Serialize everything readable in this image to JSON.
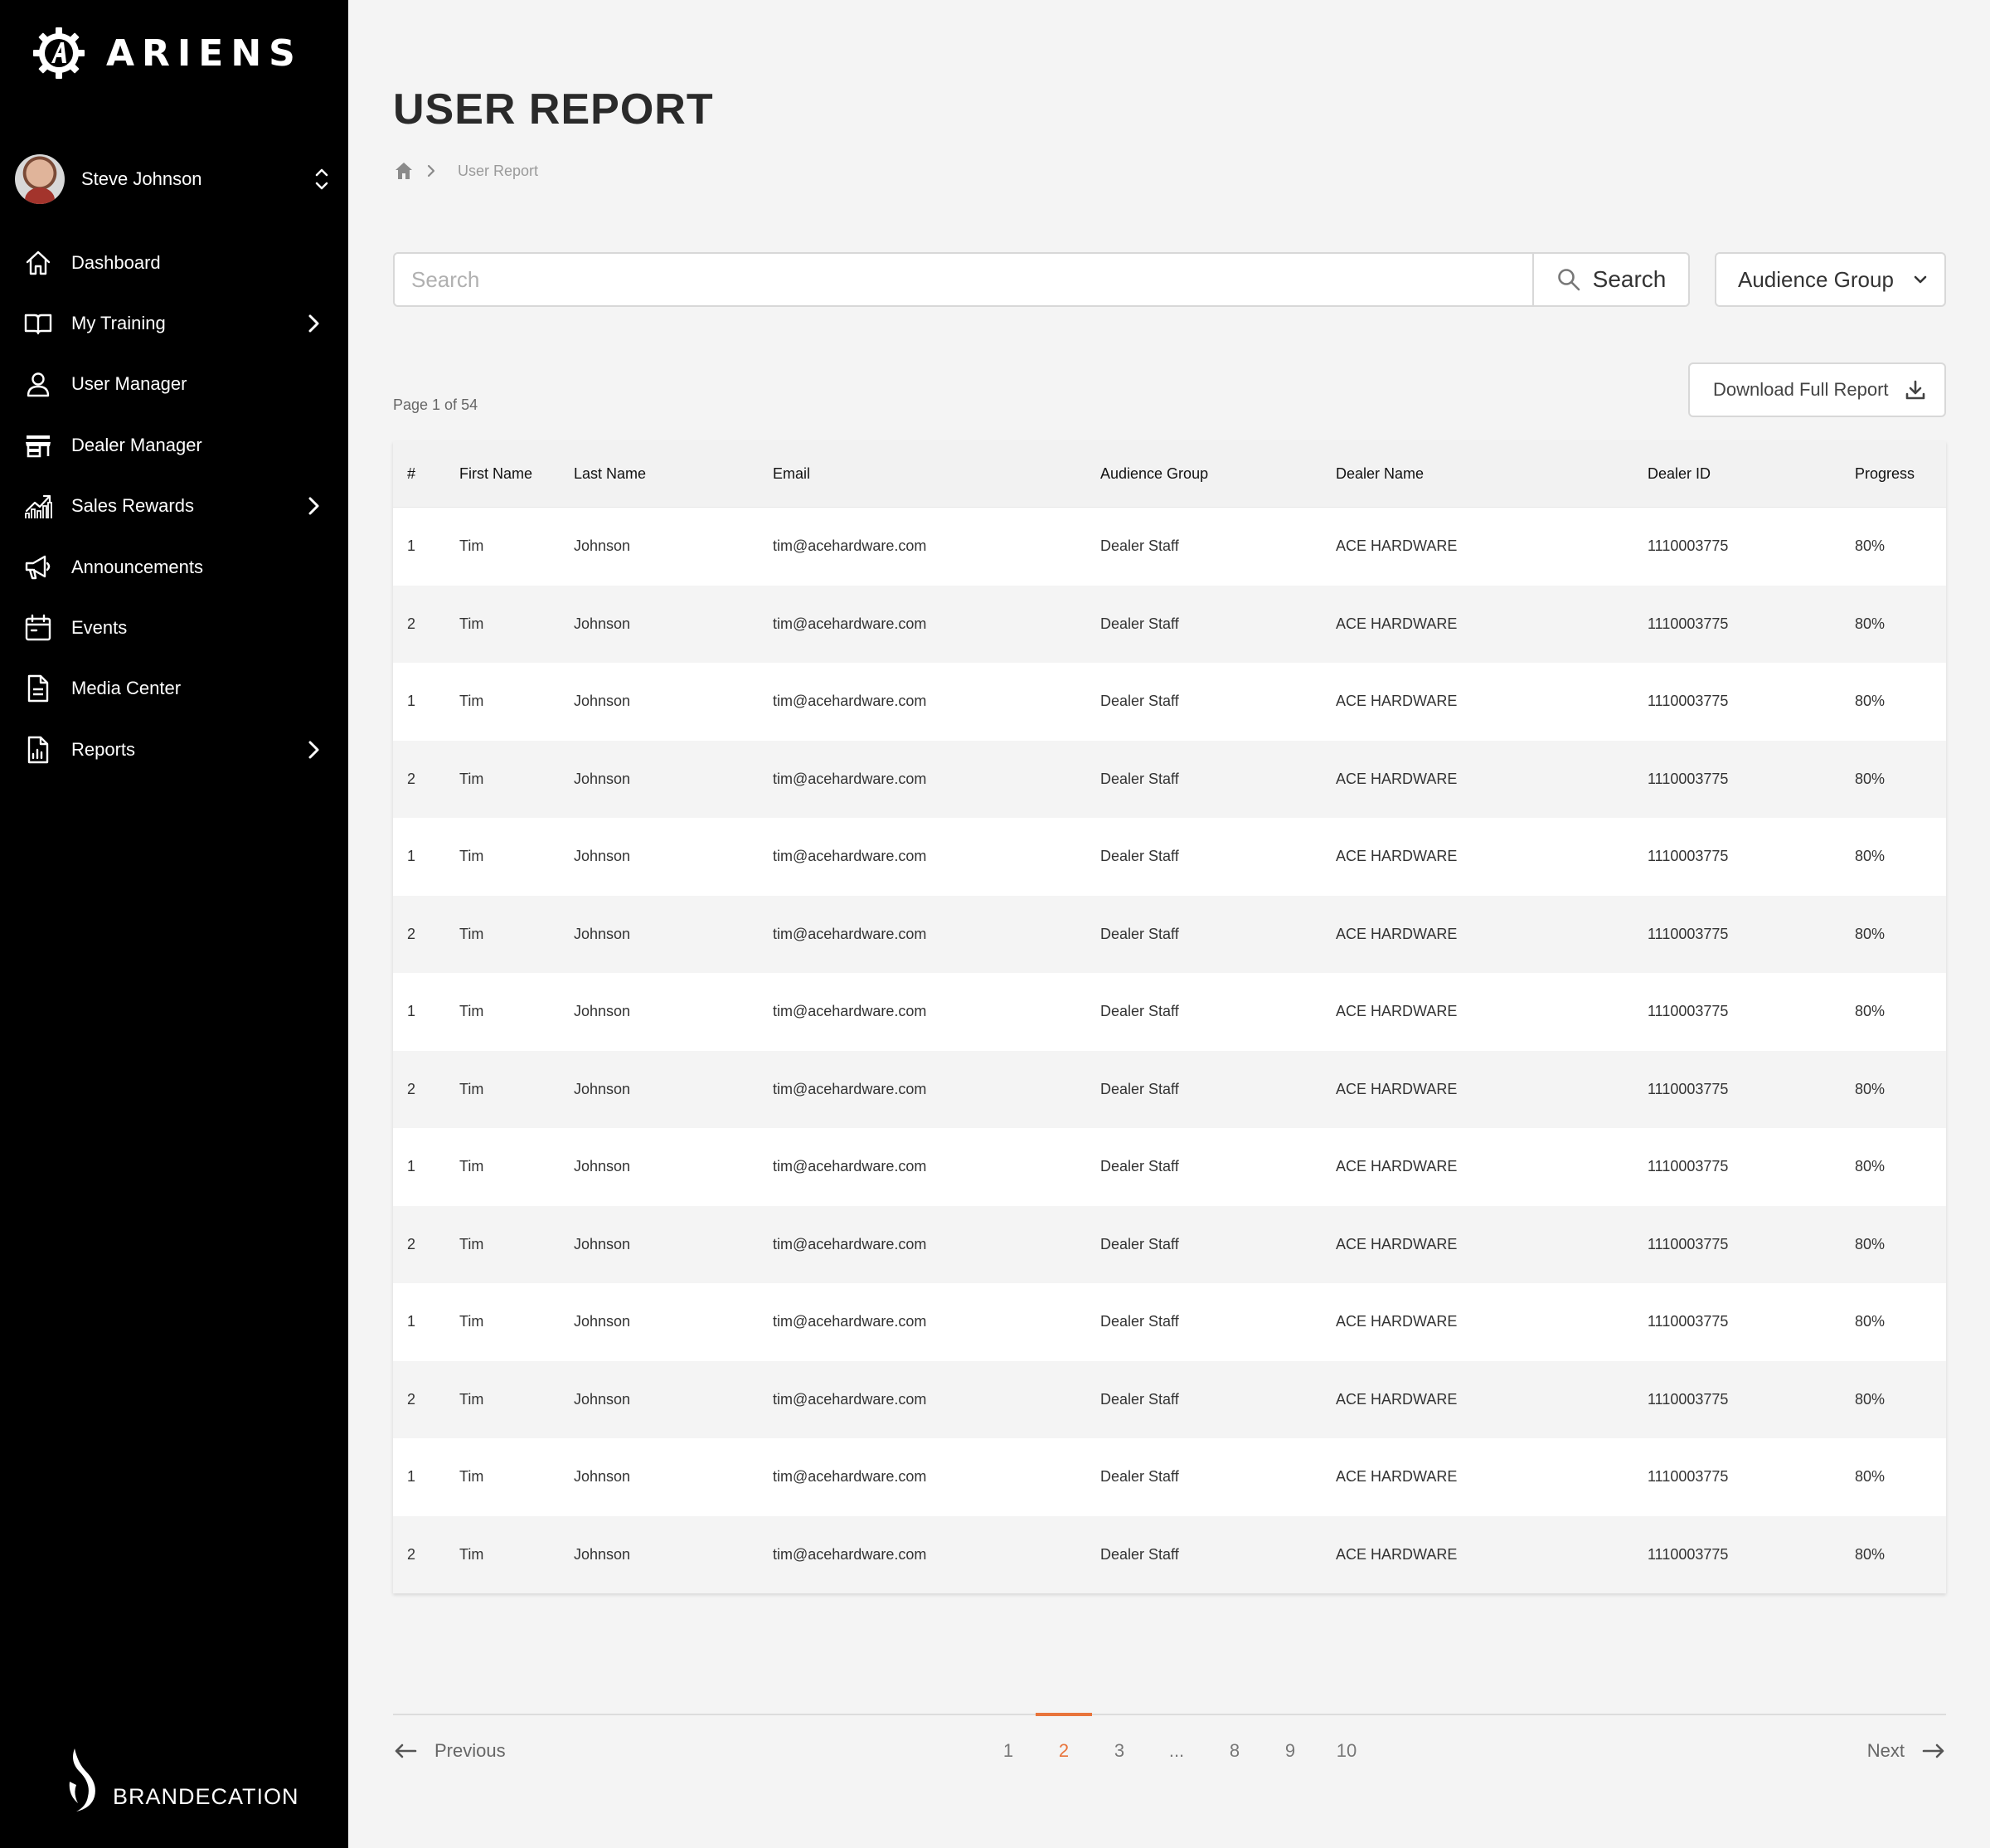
{
  "brand": {
    "logo_text": "ARIENS",
    "footer_text": "BRANDECATION"
  },
  "user": {
    "name": "Steve Johnson"
  },
  "nav": [
    {
      "label": "Dashboard",
      "icon": "home-icon",
      "chevron": false
    },
    {
      "label": "My Training",
      "icon": "book-icon",
      "chevron": true
    },
    {
      "label": "User Manager",
      "icon": "user-icon",
      "chevron": false
    },
    {
      "label": "Dealer Manager",
      "icon": "store-icon",
      "chevron": false
    },
    {
      "label": "Sales Rewards",
      "icon": "chart-icon",
      "chevron": true
    },
    {
      "label": "Announcements",
      "icon": "megaphone-icon",
      "chevron": false
    },
    {
      "label": "Events",
      "icon": "calendar-icon",
      "chevron": false
    },
    {
      "label": "Media Center",
      "icon": "document-icon",
      "chevron": false
    },
    {
      "label": "Reports",
      "icon": "report-icon",
      "chevron": true
    }
  ],
  "page": {
    "title": "USER REPORT",
    "breadcrumb_current": "User Report"
  },
  "search": {
    "placeholder": "Search",
    "button_label": "Search"
  },
  "filter": {
    "audience_label": "Audience Group"
  },
  "report": {
    "page_info": "Page 1 of 54",
    "download_label": "Download Full Report"
  },
  "table": {
    "headers": [
      "#",
      "First Name",
      "Last Name",
      "Email",
      "Audience Group",
      "Dealer Name",
      "Dealer ID",
      "Progress"
    ],
    "rows": [
      [
        "1",
        "Tim",
        "Johnson",
        "tim@acehardware.com",
        "Dealer Staff",
        "ACE HARDWARE",
        "1110003775",
        "80%"
      ],
      [
        "2",
        "Tim",
        "Johnson",
        "tim@acehardware.com",
        "Dealer Staff",
        "ACE HARDWARE",
        "1110003775",
        "80%"
      ],
      [
        "1",
        "Tim",
        "Johnson",
        "tim@acehardware.com",
        "Dealer Staff",
        "ACE HARDWARE",
        "1110003775",
        "80%"
      ],
      [
        "2",
        "Tim",
        "Johnson",
        "tim@acehardware.com",
        "Dealer Staff",
        "ACE HARDWARE",
        "1110003775",
        "80%"
      ],
      [
        "1",
        "Tim",
        "Johnson",
        "tim@acehardware.com",
        "Dealer Staff",
        "ACE HARDWARE",
        "1110003775",
        "80%"
      ],
      [
        "2",
        "Tim",
        "Johnson",
        "tim@acehardware.com",
        "Dealer Staff",
        "ACE HARDWARE",
        "1110003775",
        "80%"
      ],
      [
        "1",
        "Tim",
        "Johnson",
        "tim@acehardware.com",
        "Dealer Staff",
        "ACE HARDWARE",
        "1110003775",
        "80%"
      ],
      [
        "2",
        "Tim",
        "Johnson",
        "tim@acehardware.com",
        "Dealer Staff",
        "ACE HARDWARE",
        "1110003775",
        "80%"
      ],
      [
        "1",
        "Tim",
        "Johnson",
        "tim@acehardware.com",
        "Dealer Staff",
        "ACE HARDWARE",
        "1110003775",
        "80%"
      ],
      [
        "2",
        "Tim",
        "Johnson",
        "tim@acehardware.com",
        "Dealer Staff",
        "ACE HARDWARE",
        "1110003775",
        "80%"
      ],
      [
        "1",
        "Tim",
        "Johnson",
        "tim@acehardware.com",
        "Dealer Staff",
        "ACE HARDWARE",
        "1110003775",
        "80%"
      ],
      [
        "2",
        "Tim",
        "Johnson",
        "tim@acehardware.com",
        "Dealer Staff",
        "ACE HARDWARE",
        "1110003775",
        "80%"
      ],
      [
        "1",
        "Tim",
        "Johnson",
        "tim@acehardware.com",
        "Dealer Staff",
        "ACE HARDWARE",
        "1110003775",
        "80%"
      ],
      [
        "2",
        "Tim",
        "Johnson",
        "tim@acehardware.com",
        "Dealer Staff",
        "ACE HARDWARE",
        "1110003775",
        "80%"
      ]
    ]
  },
  "pagination": {
    "previous_label": "Previous",
    "next_label": "Next",
    "pages": [
      "1",
      "2",
      "3",
      "...",
      "8",
      "9",
      "10"
    ],
    "current": "2"
  },
  "colors": {
    "accent": "#e8743b",
    "sidebar_bg": "#000000",
    "page_bg": "#f4f4f4"
  }
}
